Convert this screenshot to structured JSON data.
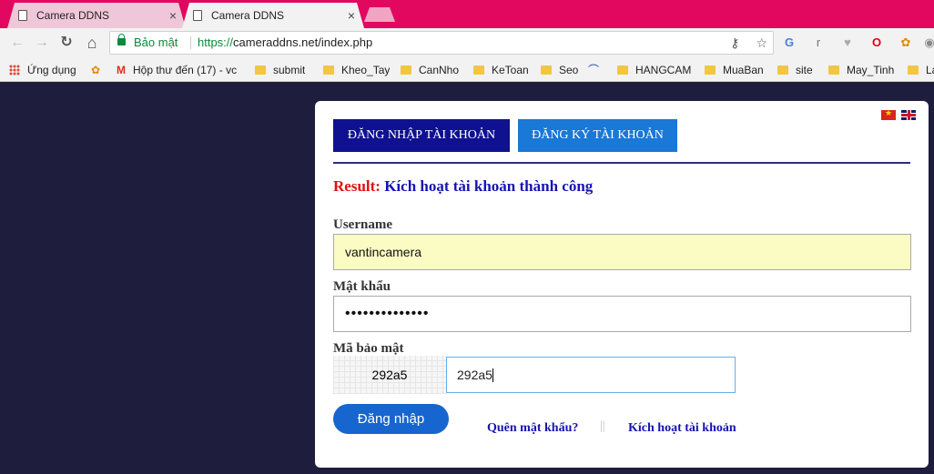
{
  "browser": {
    "tabs": [
      {
        "title": "Camera DDNS",
        "close": "×"
      },
      {
        "title": "Camera DDNS",
        "close": "×"
      }
    ],
    "nav": {
      "back": "←",
      "forward": "→",
      "reload": "↻",
      "home": "⌂"
    },
    "address": {
      "secure_label": "Bảo mật",
      "scheme": "https://",
      "host_path": "cameraddns.net/index.php"
    },
    "omnibox_icons": {
      "key": "⚷",
      "star": "☆"
    },
    "extensions": [
      {
        "icon": "translate-icon",
        "glyph": "G",
        "color": "#4a7de0"
      },
      {
        "icon": "r-icon",
        "glyph": "r",
        "color": "#777"
      },
      {
        "icon": "heart-icon",
        "glyph": "♥",
        "color": "#aaa"
      },
      {
        "icon": "opera-icon",
        "glyph": "O",
        "color": "#e0001b"
      },
      {
        "icon": "flower-icon",
        "glyph": "✿",
        "color": "#e28a00"
      },
      {
        "icon": "globe-icon",
        "glyph": "◉",
        "color": "#888"
      }
    ]
  },
  "bookmarks": [
    {
      "label": "Ứng dụng",
      "icon": "apps-icon"
    },
    {
      "label": "",
      "icon": "flower-icon"
    },
    {
      "label": "Hộp thư đến (17) - vc",
      "icon": "gmail-icon"
    },
    {
      "label": "submit",
      "icon": "folder-icon"
    },
    {
      "label": "Kheo_Tay",
      "icon": "folder-icon"
    },
    {
      "label": "CanNho",
      "icon": "folder-icon"
    },
    {
      "label": "KeToan",
      "icon": "folder-icon"
    },
    {
      "label": "Seo",
      "icon": "folder-icon"
    },
    {
      "label": "",
      "icon": "bird-icon"
    },
    {
      "label": "HANGCAM",
      "icon": "folder-icon"
    },
    {
      "label": "MuaBan",
      "icon": "folder-icon"
    },
    {
      "label": "site",
      "icon": "folder-icon"
    },
    {
      "label": "May_Tinh",
      "icon": "folder-icon"
    },
    {
      "label": "La",
      "icon": "folder-icon"
    }
  ],
  "panel": {
    "tab_login": "ĐĂNG NHẬP TÀI KHOẢN",
    "tab_register": "ĐĂNG KÝ TÀI KHOẢN",
    "result_label": "Result:",
    "result_message": "Kích hoạt tài khoản thành công",
    "username_label": "Username",
    "username_value": "vantincamera",
    "password_label": "Mật khẩu",
    "password_value": "••••••••••••••",
    "captcha_label": "Mã bảo mật",
    "captcha_image_text": "292a5",
    "captcha_value": "292a5",
    "submit_label": "Đăng nhập",
    "forgot_link": "Quên mật khẩu?",
    "link_divider": "||",
    "activate_link": "Kích hoạt tài khoản"
  },
  "colors": {
    "tab_strip": "#e2085f",
    "page_bg": "#1f1d3d",
    "tab_active_button": "#0f1191",
    "tab_inactive_button": "#1a78d6",
    "result_label": "#e01010",
    "result_message": "#1515b0",
    "submit_button": "#1765cf"
  }
}
